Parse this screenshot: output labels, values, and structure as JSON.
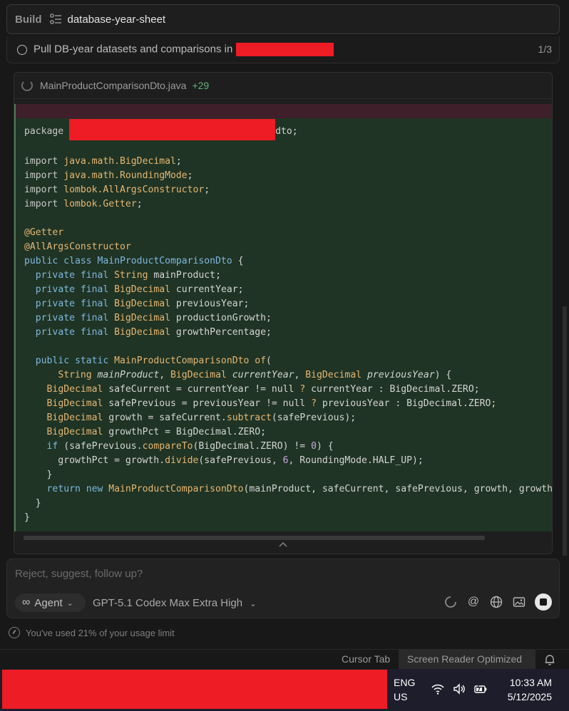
{
  "build": {
    "label": "Build",
    "title": "database-year-sheet"
  },
  "task": {
    "text": "Pull DB-year datasets and comparisons in",
    "count": "1/3"
  },
  "file": {
    "name": "MainProductComparisonDto.java",
    "additions": "+29"
  },
  "code": {
    "package_kw": "package",
    "package_tail": "dto;"
  },
  "input": {
    "placeholder": "Reject, suggest, follow up?",
    "agent_label": "Agent",
    "model_label": "GPT-5.1 Codex Max Extra High"
  },
  "usage": {
    "text": "You've used 21% of your usage limit"
  },
  "statusbar": {
    "cursor_tab": "Cursor Tab",
    "screen_reader": "Screen Reader Optimized"
  },
  "taskbar": {
    "lang_line1": "ENG",
    "lang_line2": "US",
    "time": "10:33 AM",
    "date": "5/12/2025"
  },
  "icons": {
    "build_list": "list-tree-icon",
    "task_status": "circle-icon",
    "file_status": "spinner-icon",
    "agent": "infinity-icon",
    "mention": "at-icon",
    "web": "globe-icon",
    "image": "image-icon",
    "stop": "stop-icon",
    "usage": "gauge-icon",
    "notifications": "bell-icon"
  },
  "colors": {
    "added_bg": "#1f3424",
    "removed_bg": "#3e1f2a",
    "redaction": "#ee1c24",
    "additions_green": "#5fb37a"
  }
}
